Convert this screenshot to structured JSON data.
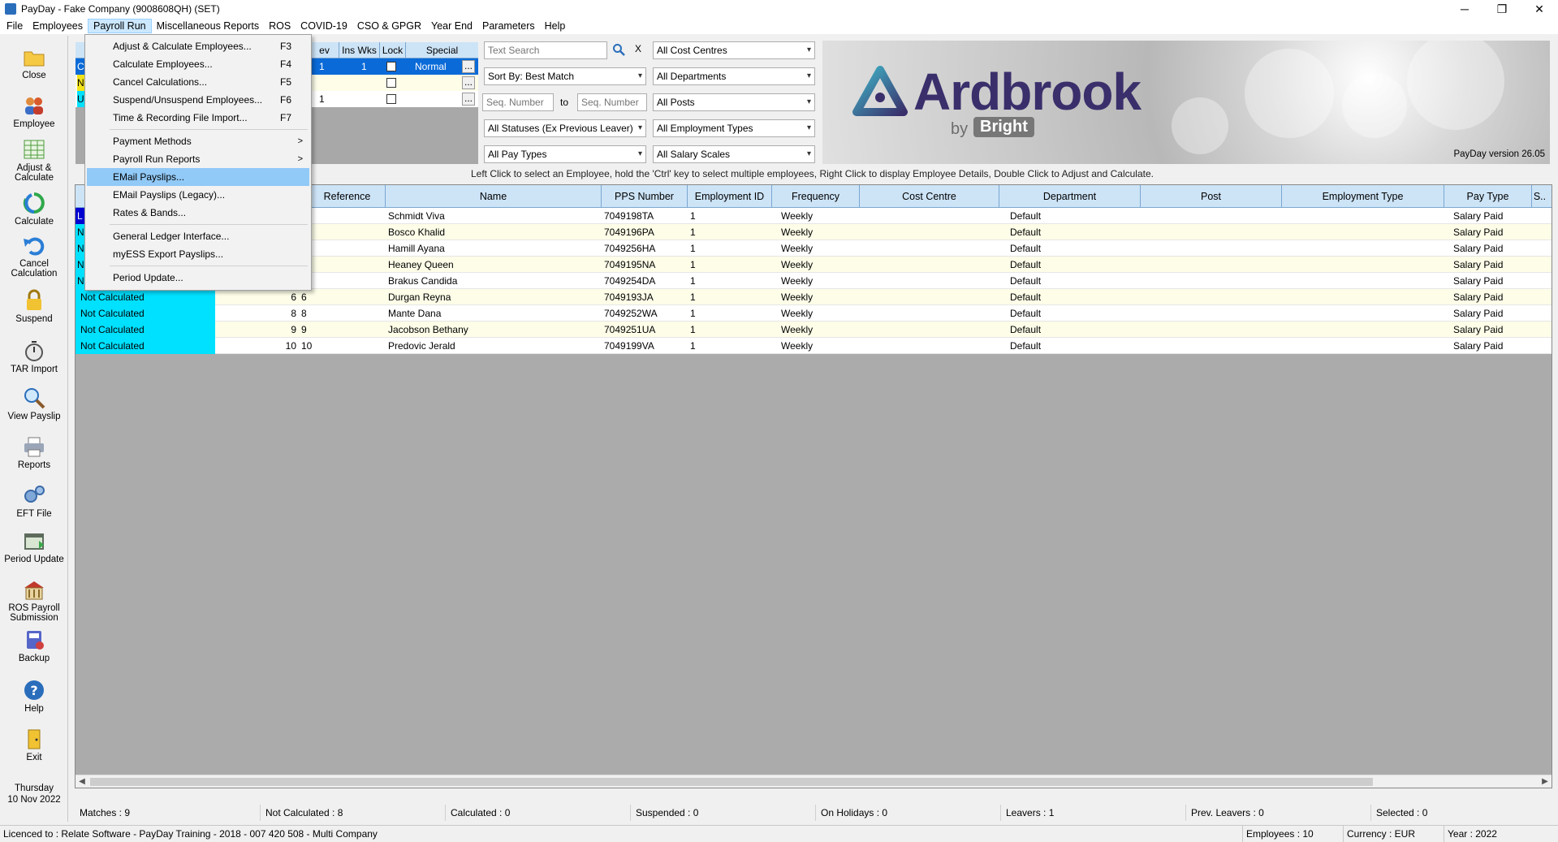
{
  "window": {
    "title": "PayDay - Fake Company (9008608QH) (SET)",
    "min": "─",
    "max": "❐",
    "close": "✕"
  },
  "menubar": [
    "File",
    "Employees",
    "Payroll Run",
    "Miscellaneous Reports",
    "ROS",
    "COVID-19",
    "CSO & GPGR",
    "Year End",
    "Parameters",
    "Help"
  ],
  "sidebar": {
    "items": [
      {
        "label": "Close",
        "icon": "folder-icon"
      },
      {
        "label": "Employee",
        "icon": "people-icon"
      },
      {
        "label": "Adjust & Calculate",
        "icon": "spreadsheet-icon"
      },
      {
        "label": "Calculate",
        "icon": "recycle-icon"
      },
      {
        "label": "Cancel Calculation",
        "icon": "undo-icon"
      },
      {
        "label": "Suspend",
        "icon": "lock-icon"
      },
      {
        "label": "TAR Import",
        "icon": "stopwatch-icon"
      },
      {
        "label": "View Payslip",
        "icon": "magnifier-icon"
      },
      {
        "label": "Reports",
        "icon": "printer-icon"
      },
      {
        "label": "EFT File",
        "icon": "gears-icon"
      },
      {
        "label": "Period Update",
        "icon": "calendar-icon"
      },
      {
        "label": "ROS Payroll Submission",
        "icon": "building-icon"
      },
      {
        "label": "Backup",
        "icon": "backup-icon"
      },
      {
        "label": "Help",
        "icon": "help-icon"
      },
      {
        "label": "Exit",
        "icon": "exit-door-icon"
      }
    ],
    "day": "Thursday",
    "date": "10 Nov 2022"
  },
  "topgrid": {
    "headers": [
      "ev Per.",
      "Ins Wks",
      "Lock",
      "Special"
    ],
    "rows": [
      {
        "lead": "C",
        "per": "1",
        "wks": "1",
        "special": "Normal"
      },
      {
        "lead": "N",
        "per": "",
        "wks": "",
        "special": ""
      },
      {
        "lead": "U",
        "per": "1",
        "wks": "",
        "special": ""
      }
    ],
    "more": "..."
  },
  "filters": {
    "search_placeholder": "Text Search",
    "clear": "X",
    "sort": "Sort By: Best Match",
    "seq_from_placeholder": "Seq. Number",
    "to": "to",
    "seq_to_placeholder": "Seq. Number",
    "statuses": "All Statuses (Ex Previous Leaver)",
    "pay_types": "All Pay Types",
    "cost_centres": "All Cost Centres",
    "departments": "All Departments",
    "posts": "All Posts",
    "employment_types": "All Employment Types",
    "salary_scales": "All Salary Scales"
  },
  "logo": {
    "brand": "Ardbrook",
    "by": "by",
    "bright": "Bright",
    "version": "PayDay version 26.05"
  },
  "hint": "Left Click to select an Employee,  hold the 'Ctrl' key to select multiple employees,  Right Click to display Employee Details,  Double Click to Adjust and Calculate.",
  "grid": {
    "headers": [
      "Reference",
      "Name",
      "PPS Number",
      "Employment ID",
      "Frequency",
      "Cost Centre",
      "Department",
      "Post",
      "Employment Type",
      "Pay Type",
      "S.."
    ],
    "rows": [
      {
        "status": "",
        "seq": "",
        "ref": "",
        "name": "Schmidt Viva",
        "pps": "7049198TA",
        "emp": "1",
        "freq": "Weekly",
        "dept": "Default",
        "pay": "Salary Paid",
        "lead": "L",
        "lead_color": "#0000d0"
      },
      {
        "status": "",
        "seq": "",
        "ref": "",
        "name": "Bosco Khalid",
        "pps": "7049196PA",
        "emp": "1",
        "freq": "Weekly",
        "dept": "Default",
        "pay": "Salary Paid",
        "lead": "N",
        "lead_color": "#00e0ff"
      },
      {
        "status": "",
        "seq": "",
        "ref": "",
        "name": "Hamill Ayana",
        "pps": "7049256HA",
        "emp": "1",
        "freq": "Weekly",
        "dept": "Default",
        "pay": "Salary Paid",
        "lead": "N",
        "lead_color": "#00e0ff"
      },
      {
        "status": "",
        "seq": "",
        "ref": "",
        "name": "Heaney Queen",
        "pps": "7049195NA",
        "emp": "1",
        "freq": "Weekly",
        "dept": "Default",
        "pay": "Salary Paid",
        "lead": "N",
        "lead_color": "#00e0ff"
      },
      {
        "status": "",
        "seq": "",
        "ref": "",
        "name": "Brakus Candida",
        "pps": "7049254DA",
        "emp": "1",
        "freq": "Weekly",
        "dept": "Default",
        "pay": "Salary Paid",
        "lead": "N",
        "lead_color": "#00e0ff"
      },
      {
        "status": "Not Calculated",
        "seq": "6",
        "ref": "6",
        "name": "Durgan Reyna",
        "pps": "7049193JA",
        "emp": "1",
        "freq": "Weekly",
        "dept": "Default",
        "pay": "Salary Paid"
      },
      {
        "status": "Not Calculated",
        "seq": "8",
        "ref": "8",
        "name": "Mante Dana",
        "pps": "7049252WA",
        "emp": "1",
        "freq": "Weekly",
        "dept": "Default",
        "pay": "Salary Paid"
      },
      {
        "status": "Not Calculated",
        "seq": "9",
        "ref": "9",
        "name": "Jacobson Bethany",
        "pps": "7049251UA",
        "emp": "1",
        "freq": "Weekly",
        "dept": "Default",
        "pay": "Salary Paid"
      },
      {
        "status": "Not Calculated",
        "seq": "10",
        "ref": "10",
        "name": "Predovic Jerald",
        "pps": "7049199VA",
        "emp": "1",
        "freq": "Weekly",
        "dept": "Default",
        "pay": "Salary Paid"
      }
    ]
  },
  "status": [
    "Matches : 9",
    "Not Calculated : 8",
    "Calculated : 0",
    "Suspended : 0",
    "On Holidays : 0",
    "Leavers : 1",
    "Prev. Leavers : 0",
    "Selected : 0"
  ],
  "license": {
    "text": "Licenced to : Relate Software - PayDay Training - 2018 - 007 420 508 - Multi Company",
    "employees": "Employees : 10",
    "currency": "Currency : EUR",
    "year": "Year : 2022"
  },
  "dropdown": [
    {
      "label": "Adjust & Calculate Employees...",
      "shortcut": "F3"
    },
    {
      "label": "Calculate Employees...",
      "shortcut": "F4"
    },
    {
      "label": "Cancel Calculations...",
      "shortcut": "F5"
    },
    {
      "label": "Suspend/Unsuspend Employees...",
      "shortcut": "F6"
    },
    {
      "label": "Time & Recording File Import...",
      "shortcut": "F7"
    },
    {
      "label": "Payment Methods",
      "submenu": ">"
    },
    {
      "label": "Payroll Run Reports",
      "submenu": ">"
    },
    {
      "label": "EMail Payslips...",
      "highlight": true
    },
    {
      "label": "EMail Payslips (Legacy)..."
    },
    {
      "label": "Rates & Bands..."
    },
    {
      "label": "General Ledger Interface..."
    },
    {
      "label": "myESS Export Payslips..."
    },
    {
      "label": "Period Update..."
    }
  ],
  "colors": {
    "accent": "#cde4f7",
    "not_calculated": "#00e0ff",
    "highlight": "#91c9f7",
    "brand": "#3a2f6b"
  }
}
